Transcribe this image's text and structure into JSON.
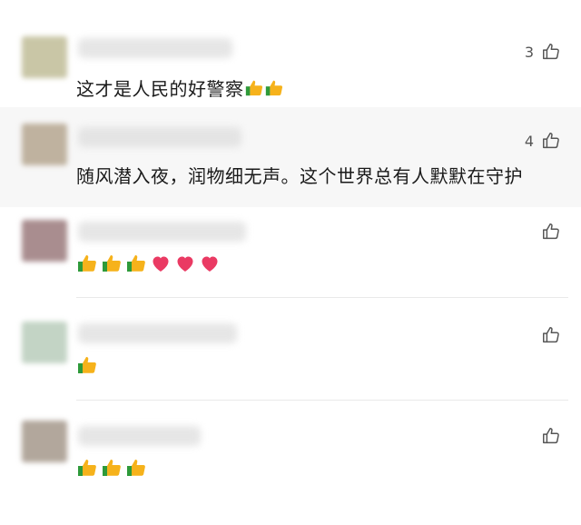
{
  "colors": {
    "text": "#1a1a1a",
    "like": "#555555",
    "thumb": "#f6b21b",
    "cuff": "#2e9a3a",
    "heart": "#ea3a63"
  },
  "icons": {
    "like": "thumbs-up-outline-icon",
    "thumb_emoji": "thumbs-up-emoji",
    "heart_emoji": "heart-emoji"
  },
  "comments": [
    {
      "text": "这才是人民的好警察",
      "emojis": [
        "thumb",
        "thumb"
      ],
      "likes": "3"
    },
    {
      "text": "随风潜入夜，润物细无声。这个世界总有人默默在守护",
      "emojis": [],
      "likes": "4"
    },
    {
      "text": "",
      "emojis": [
        "thumb",
        "thumb",
        "thumb",
        "heart",
        "heart",
        "heart"
      ],
      "likes": ""
    },
    {
      "text": "",
      "emojis": [
        "thumb"
      ],
      "likes": ""
    },
    {
      "text": "",
      "emojis": [
        "thumb",
        "thumb",
        "thumb"
      ],
      "likes": ""
    }
  ]
}
